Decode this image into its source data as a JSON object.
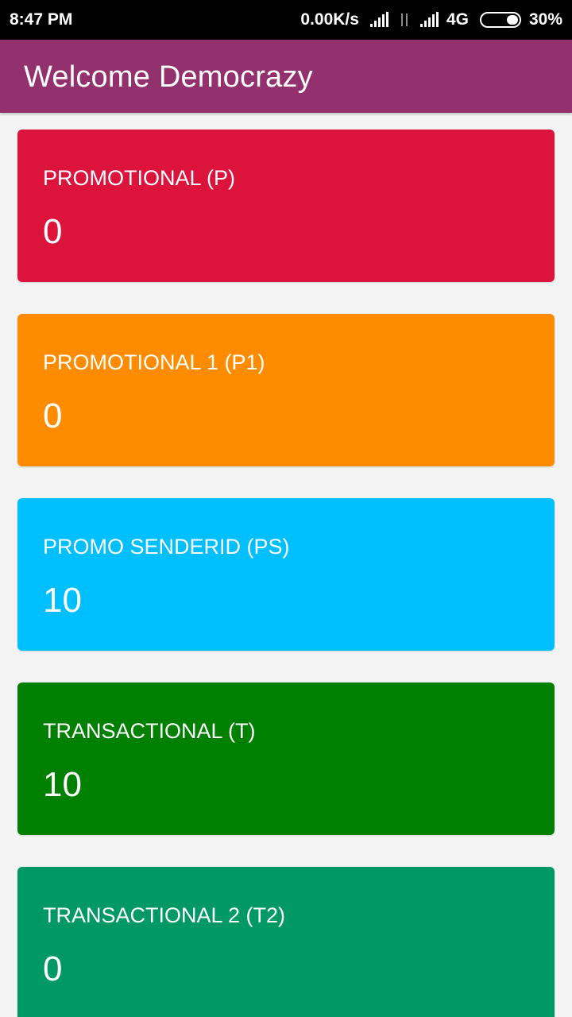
{
  "status_bar": {
    "time": "8:47 PM",
    "speed": "0.00K/s",
    "network": "4G",
    "battery": "30%",
    "icons": [
      "signal-icon",
      "data-activity-icon",
      "signal-icon",
      "battery-icon"
    ]
  },
  "app_bar": {
    "title": "Welcome Democrazy",
    "color": "#93306e"
  },
  "cards": [
    {
      "label": "PROMOTIONAL (P)",
      "value": "0",
      "color": "#dc143c"
    },
    {
      "label": "PROMOTIONAL 1 (P1)",
      "value": "0",
      "color": "#ff8c00"
    },
    {
      "label": "PROMO SENDERID (PS)",
      "value": "10",
      "color": "#00bfff"
    },
    {
      "label": "TRANSACTIONAL (T)",
      "value": "10",
      "color": "#008000"
    },
    {
      "label": "TRANSACTIONAL 2 (T2)",
      "value": "0",
      "color": "#009966"
    }
  ]
}
